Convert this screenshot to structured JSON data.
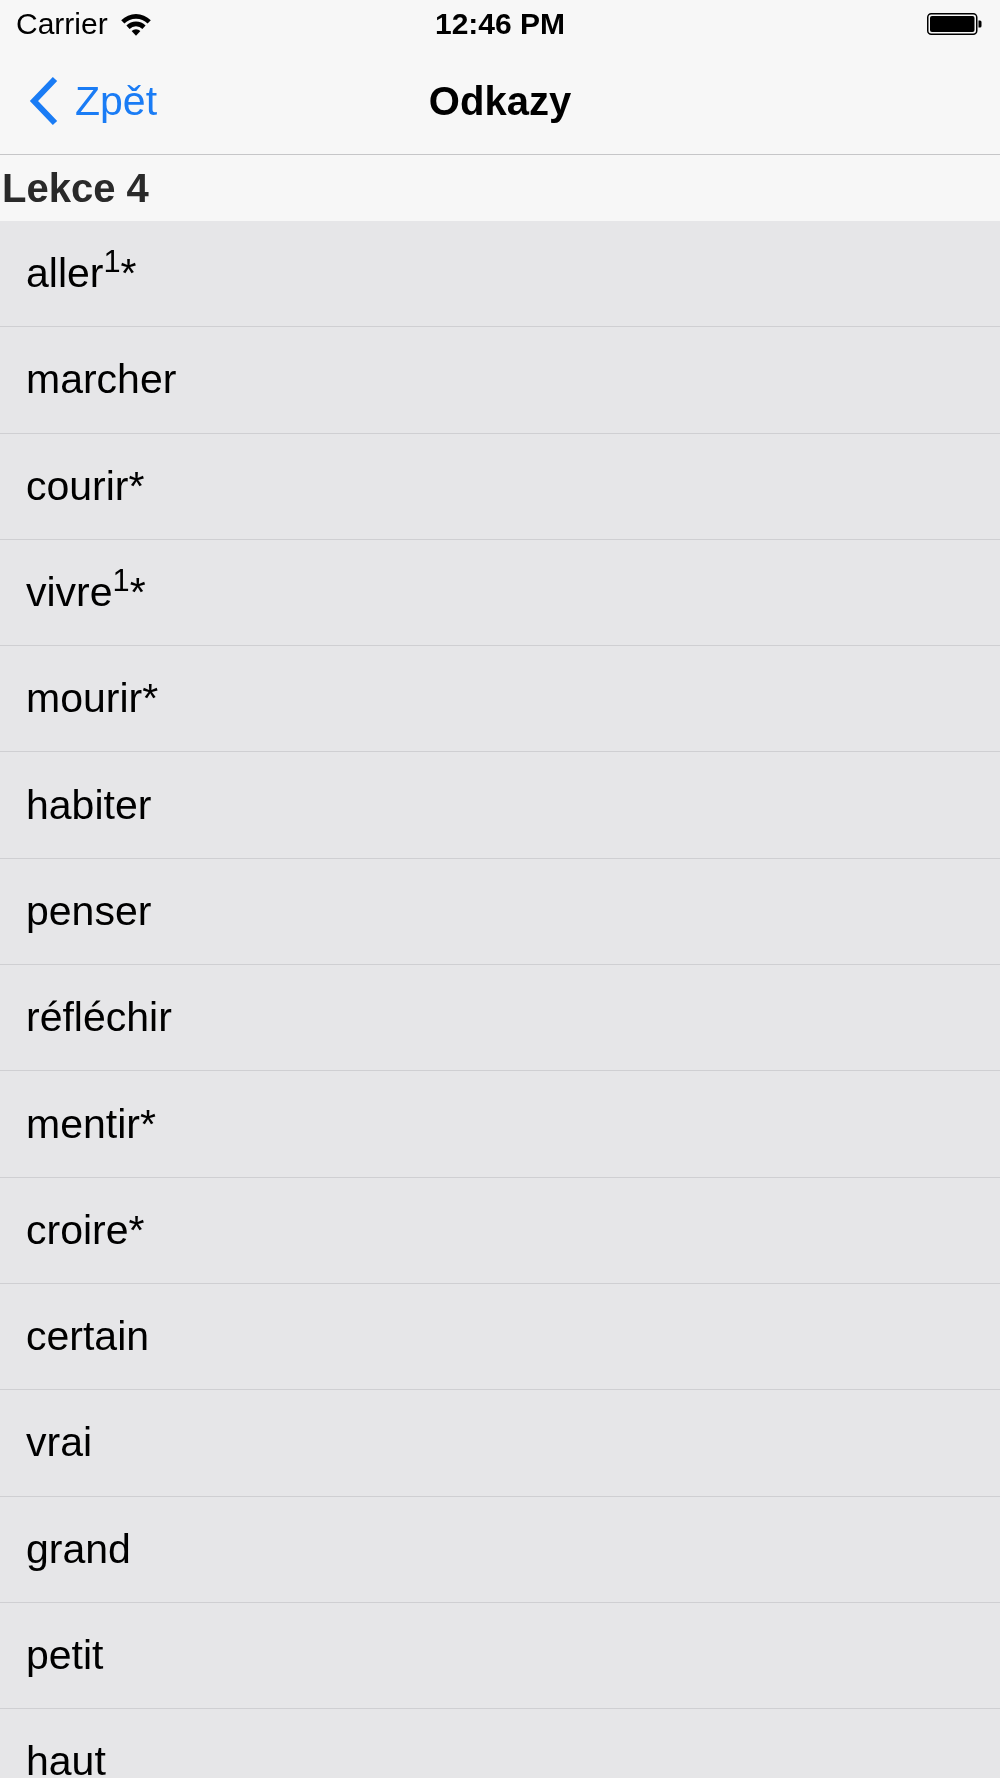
{
  "status_bar": {
    "carrier": "Carrier",
    "time": "12:46 PM"
  },
  "nav_bar": {
    "back_button": "Zpět",
    "title": "Odkazy"
  },
  "section": {
    "header": "Lekce 4",
    "items": [
      "aller$^{1}$*",
      "marcher",
      "courir*",
      "vivre$^{1}$*",
      "mourir*",
      "habiter",
      "penser",
      "réfléchir",
      "mentir*",
      "croire*",
      "certain",
      "vrai",
      "grand",
      "petit",
      "haut"
    ]
  }
}
